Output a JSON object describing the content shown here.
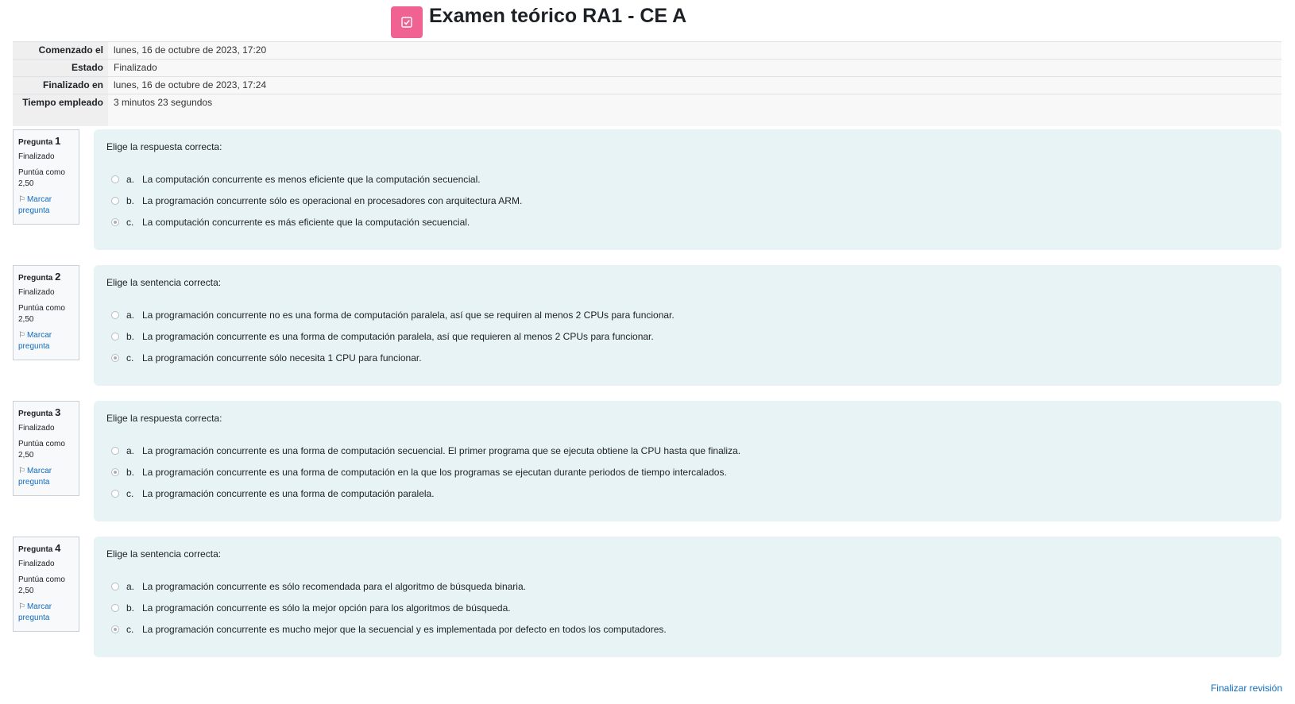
{
  "header": {
    "title": "Examen teórico RA1 - CE A",
    "icon": "quiz-icon"
  },
  "summary": [
    {
      "label": "Comenzado el",
      "value": "lunes, 16 de octubre de 2023, 17:20"
    },
    {
      "label": "Estado",
      "value": "Finalizado"
    },
    {
      "label": "Finalizado en",
      "value": "lunes, 16 de octubre de 2023, 17:24"
    },
    {
      "label": "Tiempo empleado",
      "value": "3 minutos 23 segundos"
    }
  ],
  "questions": [
    {
      "prefix": "Pregunta",
      "number": "1",
      "state": "Finalizado",
      "grade_label": "Puntúa como",
      "grade_value": "2,50",
      "flag_label": "Marcar pregunta",
      "text": "Elige la respuesta correcta:",
      "answers": [
        {
          "letter": "a.",
          "text": "La computación concurrente es menos eficiente que la computación secuencial.",
          "selected": false
        },
        {
          "letter": "b.",
          "text": "La programación concurrente sólo es operacional en procesadores con arquitectura ARM.",
          "selected": false
        },
        {
          "letter": "c.",
          "text": "La computación concurrente es más eficiente que la computación secuencial.",
          "selected": true
        }
      ]
    },
    {
      "prefix": "Pregunta",
      "number": "2",
      "state": "Finalizado",
      "grade_label": "Puntúa como",
      "grade_value": "2,50",
      "flag_label": "Marcar pregunta",
      "text": "Elige la sentencia correcta:",
      "answers": [
        {
          "letter": "a.",
          "text": "La programación concurrente no es una forma de computación paralela, así que se requiren al menos 2 CPUs para funcionar.",
          "selected": false
        },
        {
          "letter": "b.",
          "text": "La programación concurrente es una forma de computación paralela, así que requieren al menos 2 CPUs para funcionar.",
          "selected": false
        },
        {
          "letter": "c.",
          "text": "La programación concurrente sólo necesita 1 CPU para funcionar.",
          "selected": true
        }
      ]
    },
    {
      "prefix": "Pregunta",
      "number": "3",
      "state": "Finalizado",
      "grade_label": "Puntúa como",
      "grade_value": "2,50",
      "flag_label": "Marcar pregunta",
      "text": "Elige la respuesta correcta:",
      "answers": [
        {
          "letter": "a.",
          "text": "La programación concurrente es una forma de computación secuencial. El primer programa que se ejecuta obtiene la CPU hasta que finaliza.",
          "selected": false
        },
        {
          "letter": "b.",
          "text": "La programación concurrente es una forma de computación en la que los programas se ejecutan durante periodos de tiempo intercalados.",
          "selected": true
        },
        {
          "letter": "c.",
          "text": "La programación concurrente es una forma de computación paralela.",
          "selected": false
        }
      ]
    },
    {
      "prefix": "Pregunta",
      "number": "4",
      "state": "Finalizado",
      "grade_label": "Puntúa como",
      "grade_value": "2,50",
      "flag_label": "Marcar pregunta",
      "text": "Elige la sentencia correcta:",
      "answers": [
        {
          "letter": "a.",
          "text": "La programación concurrente es sólo recomendada para el algoritmo de búsqueda binaria.",
          "selected": false
        },
        {
          "letter": "b.",
          "text": "La programación concurrente es sólo la mejor opción para los algoritmos de búsqueda.",
          "selected": false
        },
        {
          "letter": "c.",
          "text": "La programación concurrente es mucho mejor que la secuencial y es implementada por defecto en todos los computadores.",
          "selected": true
        }
      ]
    }
  ],
  "footer": {
    "finish_label": "Finalizar revisión"
  }
}
